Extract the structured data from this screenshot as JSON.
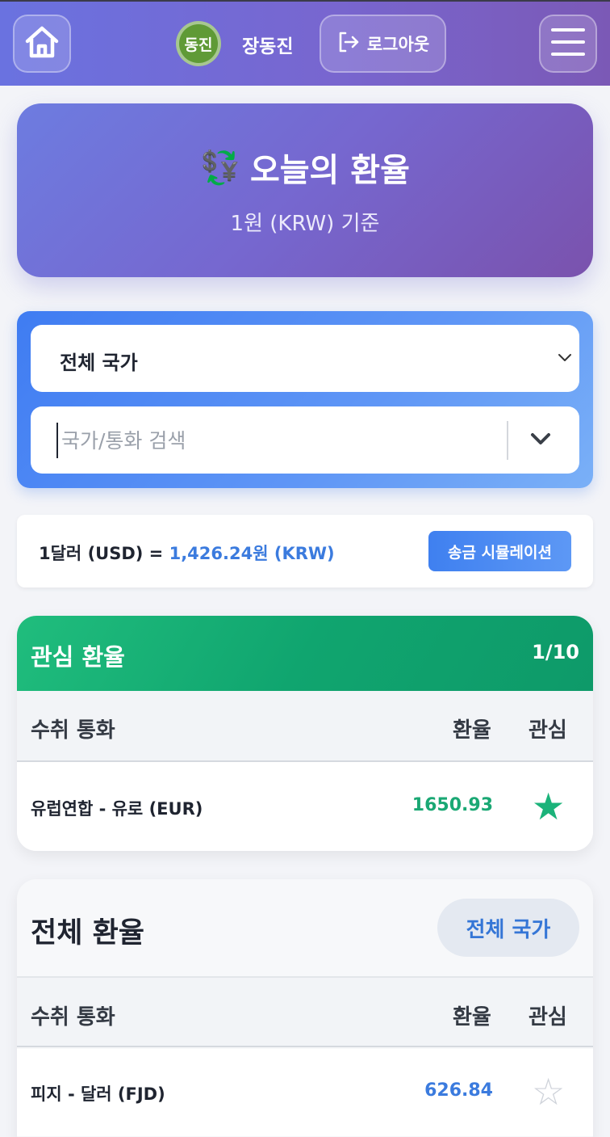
{
  "header": {
    "avatar_text": "동진",
    "username": "장동진",
    "logout_label": "로그아웃"
  },
  "hero": {
    "icon": "💱",
    "title": "오늘의 환율",
    "subtitle": "1원 (KRW) 기준"
  },
  "filters": {
    "country_select_value": "전체 국가",
    "search_placeholder": "국가/통화 검색",
    "search_value": ""
  },
  "usd_rate": {
    "prefix": "1달러 (USD) =",
    "value": "1,426.24원 (KRW)",
    "simulation_button": "송금 시뮬레이션"
  },
  "favorites": {
    "title": "관심 환율",
    "count": "1/10",
    "columns": [
      "수취 통화",
      "환율",
      "관심"
    ],
    "rows": [
      {
        "name": "유럽연합 - 유로 (EUR)",
        "rate": "1650.93",
        "favorited": true,
        "rate_color": "#1aa874"
      }
    ]
  },
  "all_rates": {
    "title": "전체 환율",
    "filter_button": "전체 국가",
    "columns": [
      "수취 통화",
      "환율",
      "관심"
    ],
    "rows": [
      {
        "name": "피지 - 달러 (FJD)",
        "rate": "626.84",
        "favorited": false,
        "rate_color": "#3b7bde"
      }
    ]
  },
  "colors": {
    "header_gradient_start": "#6a72e0",
    "header_gradient_end": "#7b59b6",
    "favorites_green": "#12a86f",
    "accent_blue": "#3b7bde",
    "star_filled": "#1bb37a",
    "star_empty": "#cfd3da"
  }
}
